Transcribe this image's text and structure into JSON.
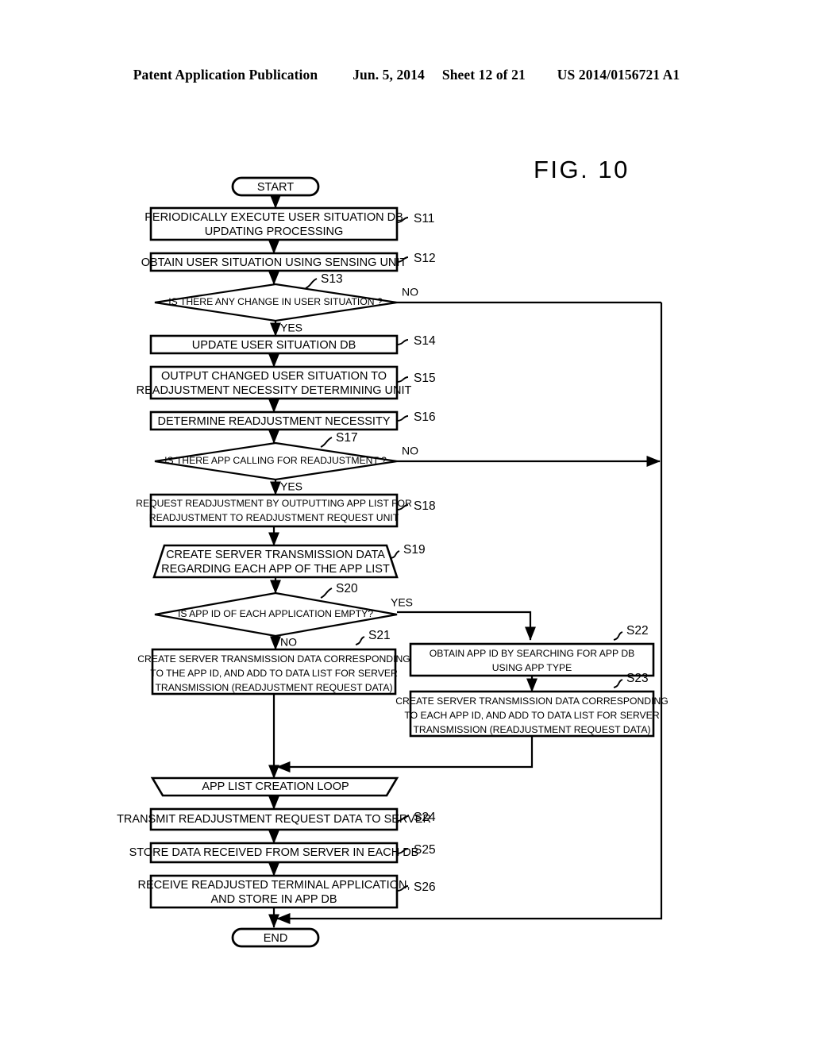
{
  "header": {
    "publication": "Patent Application Publication",
    "date": "Jun. 5, 2014",
    "sheet": "Sheet 12 of 21",
    "patent_number": "US 2014/0156721 A1"
  },
  "figure": {
    "label": "FIG. 10"
  },
  "flowchart": {
    "start": "START",
    "end": "END",
    "nodes": [
      {
        "id": "S11",
        "step": "S11",
        "type": "process",
        "lines": [
          "PERIODICALLY EXECUTE USER SITUATION DB",
          "UPDATING PROCESSING"
        ]
      },
      {
        "id": "S12",
        "step": "S12",
        "type": "process",
        "lines": [
          "OBTAIN USER SITUATION USING SENSING UNIT"
        ]
      },
      {
        "id": "S13",
        "step": "S13",
        "type": "decision",
        "lines": [
          "IS THERE ANY CHANGE IN USER SITUATION ?"
        ],
        "yes": "YES",
        "no": "NO"
      },
      {
        "id": "S14",
        "step": "S14",
        "type": "process",
        "lines": [
          "UPDATE USER SITUATION DB"
        ]
      },
      {
        "id": "S15",
        "step": "S15",
        "type": "process",
        "lines": [
          "OUTPUT CHANGED USER SITUATION TO",
          "READJUSTMENT NECESSITY DETERMINING UNIT"
        ]
      },
      {
        "id": "S16",
        "step": "S16",
        "type": "process",
        "lines": [
          "DETERMINE READJUSTMENT NECESSITY"
        ]
      },
      {
        "id": "S17",
        "step": "S17",
        "type": "decision",
        "lines": [
          "IS THERE APP CALLING FOR READJUSTMENT ?"
        ],
        "yes": "YES",
        "no": "NO"
      },
      {
        "id": "S18",
        "step": "S18",
        "type": "process",
        "lines": [
          "REQUEST READJUSTMENT BY OUTPUTTING APP LIST FOR",
          "READJUSTMENT TO READJUSTMENT REQUEST UNIT"
        ]
      },
      {
        "id": "S19",
        "step": "S19",
        "type": "loop-start",
        "lines": [
          "CREATE SERVER TRANSMISSION DATA",
          "REGARDING EACH APP OF THE APP LIST"
        ]
      },
      {
        "id": "S20",
        "step": "S20",
        "type": "decision",
        "lines": [
          "IS APP ID OF EACH APPLICATION EMPTY?"
        ],
        "yes": "YES",
        "no": "NO"
      },
      {
        "id": "S21",
        "step": "S21",
        "type": "process",
        "lines": [
          "CREATE SERVER TRANSMISSION DATA CORRESPONDING",
          "TO THE APP ID, AND ADD TO DATA LIST FOR SERVER",
          "TRANSMISSION (READJUSTMENT REQUEST DATA)"
        ]
      },
      {
        "id": "S22",
        "step": "S22",
        "type": "process",
        "lines": [
          "OBTAIN APP ID BY SEARCHING FOR APP DB",
          "USING APP TYPE"
        ]
      },
      {
        "id": "S23",
        "step": "S23",
        "type": "process",
        "lines": [
          "CREATE SERVER TRANSMISSION DATA CORRESPONDING",
          "TO EACH APP ID, AND ADD TO DATA LIST FOR SERVER",
          "TRANSMISSION (READJUSTMENT REQUEST DATA)"
        ]
      },
      {
        "id": "LOOP_END",
        "step": "",
        "type": "loop-end",
        "lines": [
          "APP LIST CREATION LOOP"
        ]
      },
      {
        "id": "S24",
        "step": "S24",
        "type": "process",
        "lines": [
          "TRANSMIT READJUSTMENT REQUEST DATA TO SERVER"
        ]
      },
      {
        "id": "S25",
        "step": "S25",
        "type": "process",
        "lines": [
          "STORE DATA RECEIVED FROM SERVER IN EACH DB"
        ]
      },
      {
        "id": "S26",
        "step": "S26",
        "type": "process",
        "lines": [
          "RECEIVE READJUSTED TERMINAL APPLICATION,",
          "AND STORE IN APP DB"
        ]
      }
    ]
  }
}
